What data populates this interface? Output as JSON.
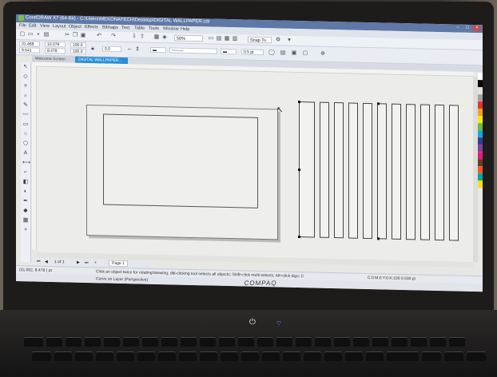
{
  "window": {
    "title": "CorelDRAW X7 (64-Bit) - C:\\Users\\MEKONATECH\\Desktop\\DIGITAL WALLPAPER.cdr",
    "min": "–",
    "max": "□",
    "close": "×"
  },
  "menu": [
    "File",
    "Edit",
    "View",
    "Layout",
    "Object",
    "Effects",
    "Bitmaps",
    "Text",
    "Table",
    "Tools",
    "Window",
    "Help"
  ],
  "toolbar": {
    "zoom": "50%",
    "snap": "Snap To"
  },
  "propbar": {
    "x": "31.468",
    "y": "9.541",
    "w": "10.079",
    "h": "8.478",
    "sx": "100.0",
    "sy": "100.0",
    "angle": "0.0",
    "outline": "0.5 pt"
  },
  "tabs": [
    "Welcome Screen",
    "DIGITAL WALLPAPER..."
  ],
  "pagenav": {
    "counter": "1 of 1",
    "page_tab": "Page 1"
  },
  "status": {
    "coords": "(31.052, 8.478 ) pt",
    "message": "Click an object twice for rotating/skewing; dbl-clicking tool selects all objects; Shift+click multi-selects; Alt+click digs; Ctrl+click selects in a group",
    "color_info": "C:0 M:0 Y:0 K:100  0.500 pt",
    "layout": "Curve on Layer (Perspective)"
  },
  "laptop": {
    "brand": "COMPAQ"
  },
  "palette_colors": [
    "#ffffff",
    "#000000",
    "#e3e3e3",
    "#a0a0a0",
    "#e8312f",
    "#f6a21d",
    "#fde70f",
    "#6cba44",
    "#1aa6d9",
    "#2f3f98",
    "#8a3d96",
    "#e6197f",
    "#6d3b1e",
    "#f15a29",
    "#00a99d",
    "#ffde17"
  ]
}
